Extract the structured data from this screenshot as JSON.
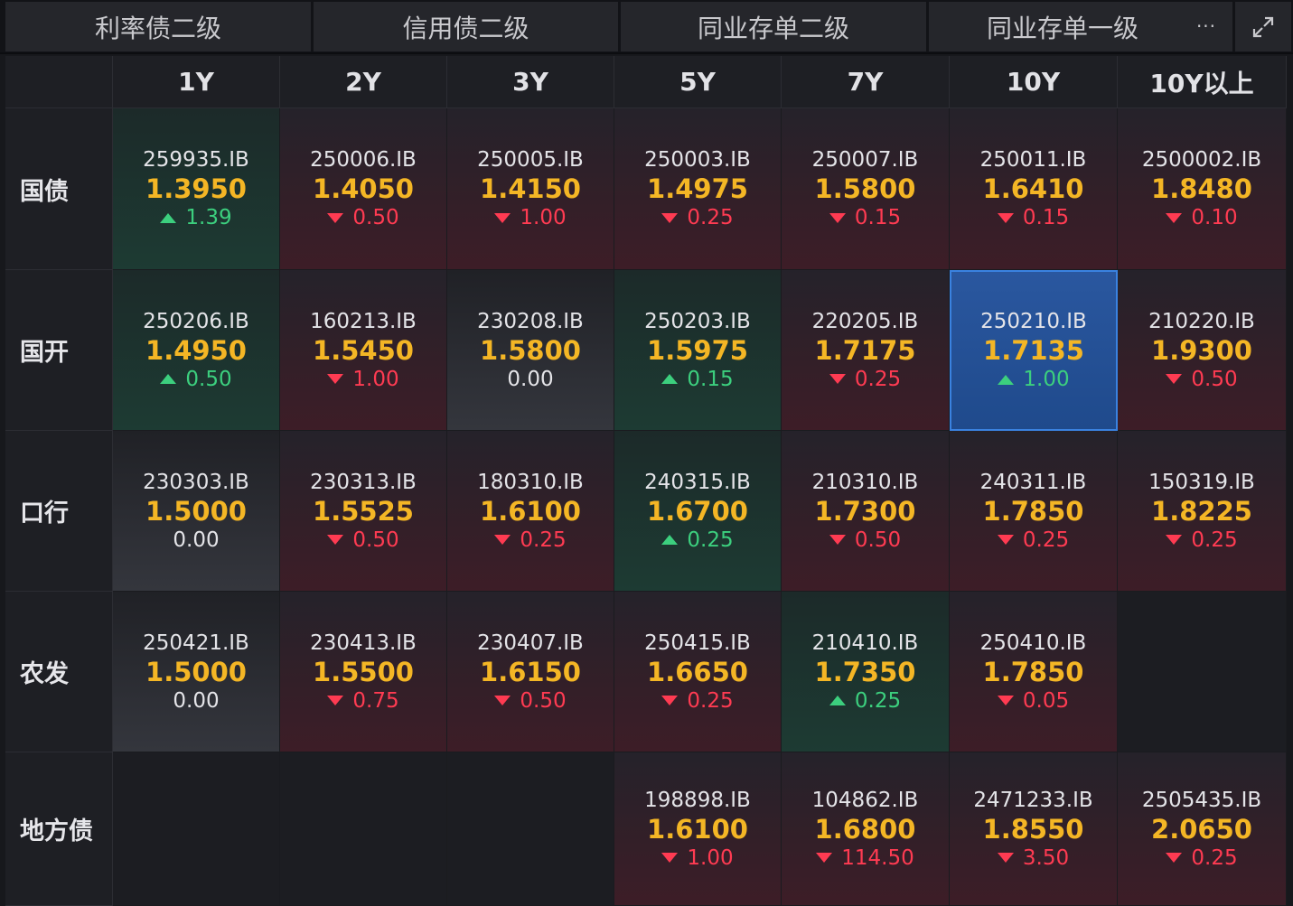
{
  "tabs": [
    {
      "label": "利率债二级",
      "active": true
    },
    {
      "label": "信用债二级",
      "active": false
    },
    {
      "label": "同业存单二级",
      "active": false
    },
    {
      "label": "同业存单一级",
      "active": false
    }
  ],
  "toolbar": {
    "more_label": "···"
  },
  "columns": [
    "1Y",
    "2Y",
    "3Y",
    "5Y",
    "7Y",
    "10Y",
    "10Y以上"
  ],
  "rows": [
    {
      "label": "国债",
      "cells": [
        {
          "code": "259935.IB",
          "yield": "1.3950",
          "change": "1.39",
          "dir": "up"
        },
        {
          "code": "250006.IB",
          "yield": "1.4050",
          "change": "0.50",
          "dir": "down"
        },
        {
          "code": "250005.IB",
          "yield": "1.4150",
          "change": "1.00",
          "dir": "down"
        },
        {
          "code": "250003.IB",
          "yield": "1.4975",
          "change": "0.25",
          "dir": "down"
        },
        {
          "code": "250007.IB",
          "yield": "1.5800",
          "change": "0.15",
          "dir": "down"
        },
        {
          "code": "250011.IB",
          "yield": "1.6410",
          "change": "0.15",
          "dir": "down"
        },
        {
          "code": "2500002.IB",
          "yield": "1.8480",
          "change": "0.10",
          "dir": "down"
        }
      ]
    },
    {
      "label": "国开",
      "cells": [
        {
          "code": "250206.IB",
          "yield": "1.4950",
          "change": "0.50",
          "dir": "up"
        },
        {
          "code": "160213.IB",
          "yield": "1.5450",
          "change": "1.00",
          "dir": "down"
        },
        {
          "code": "230208.IB",
          "yield": "1.5800",
          "change": "0.00",
          "dir": "flat"
        },
        {
          "code": "250203.IB",
          "yield": "1.5975",
          "change": "0.15",
          "dir": "up"
        },
        {
          "code": "220205.IB",
          "yield": "1.7175",
          "change": "0.25",
          "dir": "down"
        },
        {
          "code": "250210.IB",
          "yield": "1.7135",
          "change": "1.00",
          "dir": "up",
          "selected": true
        },
        {
          "code": "210220.IB",
          "yield": "1.9300",
          "change": "0.50",
          "dir": "down"
        }
      ]
    },
    {
      "label": "口行",
      "cells": [
        {
          "code": "230303.IB",
          "yield": "1.5000",
          "change": "0.00",
          "dir": "flat"
        },
        {
          "code": "230313.IB",
          "yield": "1.5525",
          "change": "0.50",
          "dir": "down"
        },
        {
          "code": "180310.IB",
          "yield": "1.6100",
          "change": "0.25",
          "dir": "down"
        },
        {
          "code": "240315.IB",
          "yield": "1.6700",
          "change": "0.25",
          "dir": "up"
        },
        {
          "code": "210310.IB",
          "yield": "1.7300",
          "change": "0.50",
          "dir": "down"
        },
        {
          "code": "240311.IB",
          "yield": "1.7850",
          "change": "0.25",
          "dir": "down"
        },
        {
          "code": "150319.IB",
          "yield": "1.8225",
          "change": "0.25",
          "dir": "down"
        }
      ]
    },
    {
      "label": "农发",
      "cells": [
        {
          "code": "250421.IB",
          "yield": "1.5000",
          "change": "0.00",
          "dir": "flat"
        },
        {
          "code": "230413.IB",
          "yield": "1.5500",
          "change": "0.75",
          "dir": "down"
        },
        {
          "code": "230407.IB",
          "yield": "1.6150",
          "change": "0.50",
          "dir": "down"
        },
        {
          "code": "250415.IB",
          "yield": "1.6650",
          "change": "0.25",
          "dir": "down"
        },
        {
          "code": "210410.IB",
          "yield": "1.7350",
          "change": "0.25",
          "dir": "up"
        },
        {
          "code": "250410.IB",
          "yield": "1.7850",
          "change": "0.05",
          "dir": "down"
        },
        null
      ]
    },
    {
      "label": "地方债",
      "cells": [
        null,
        null,
        null,
        {
          "code": "198898.IB",
          "yield": "1.6100",
          "change": "1.00",
          "dir": "down"
        },
        {
          "code": "104862.IB",
          "yield": "1.6800",
          "change": "114.50",
          "dir": "down"
        },
        {
          "code": "2471233.IB",
          "yield": "1.8550",
          "change": "3.50",
          "dir": "down"
        },
        {
          "code": "2505435.IB",
          "yield": "2.0650",
          "change": "0.25",
          "dir": "down"
        }
      ]
    }
  ]
}
